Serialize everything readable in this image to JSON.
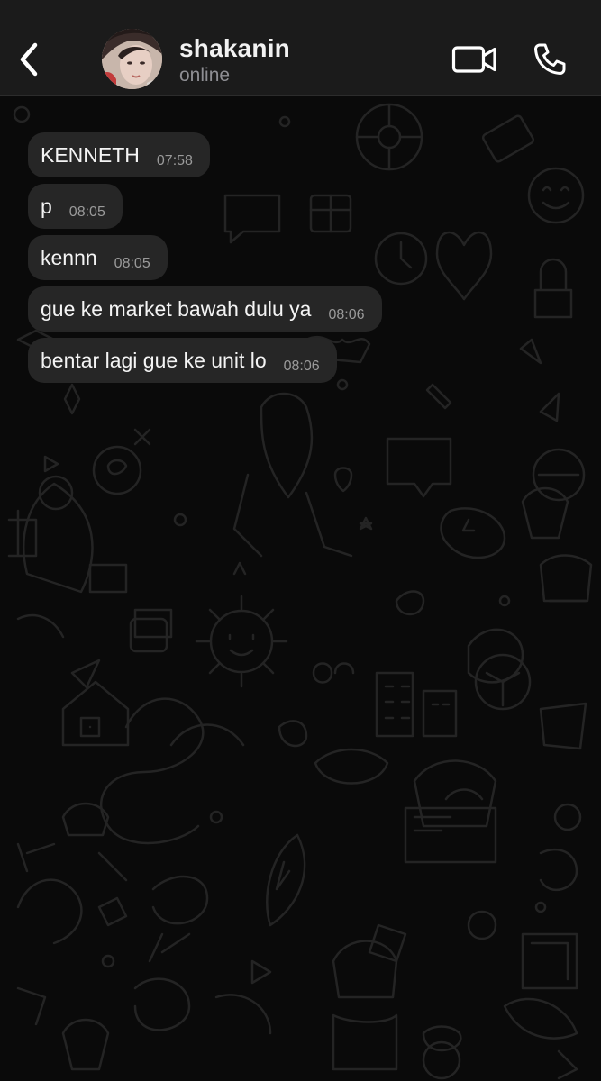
{
  "header": {
    "contact_name": "shakanin",
    "status": "online",
    "icons": {
      "back": "chevron-left-icon",
      "video": "video-camera-icon",
      "call": "phone-icon"
    }
  },
  "colors": {
    "header_bg": "#1b1b1b",
    "chat_bg": "#0a0a0a",
    "bubble_bg": "#262626",
    "text": "#f4f4f4",
    "timestamp": "#9a9a9a"
  },
  "messages": [
    {
      "text": "KENNETH",
      "time": "07:58"
    },
    {
      "text": "p",
      "time": "08:05"
    },
    {
      "text": "kennn",
      "time": "08:05"
    },
    {
      "text": "gue ke market bawah dulu ya",
      "time": "08:06"
    },
    {
      "text": "bentar lagi gue ke unit lo",
      "time": "08:06"
    }
  ]
}
